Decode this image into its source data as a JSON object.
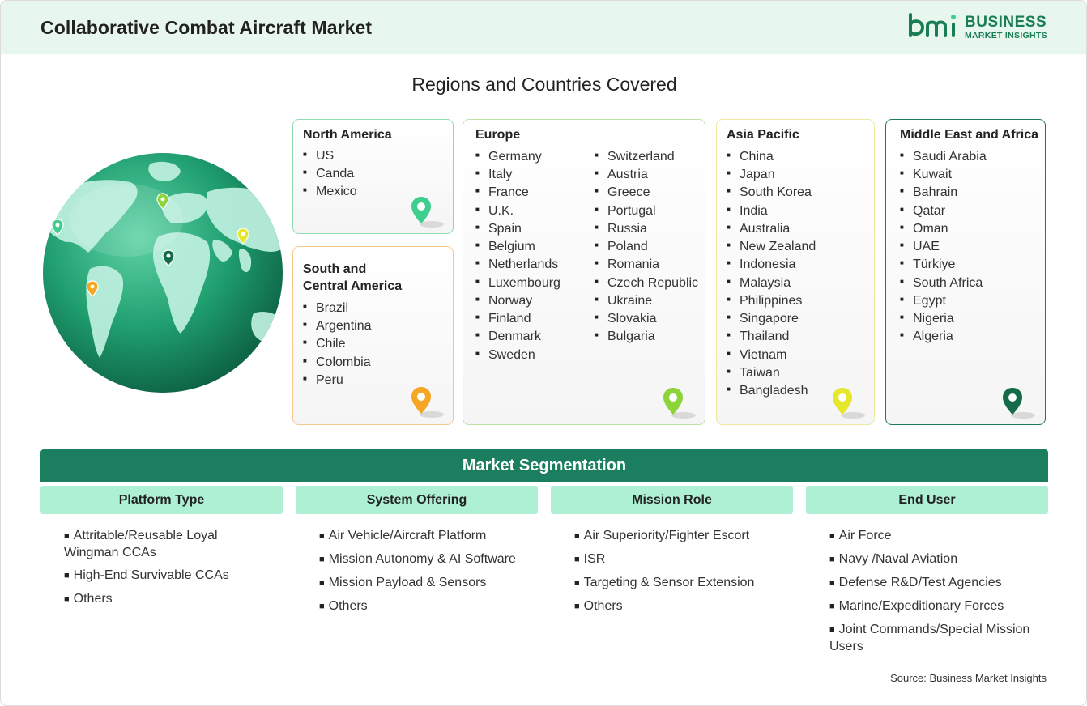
{
  "header": {
    "title": "Collaborative Combat Aircraft Market",
    "logo_line1": "BUSINESS",
    "logo_line2": "MARKET INSIGHTS",
    "brand_color": "#1a7d56"
  },
  "regions_title": "Regions and Countries Covered",
  "regions": {
    "north_america": {
      "title": "North America",
      "pin_color": "#3ecf8e",
      "countries": [
        "US",
        "Canda",
        "Mexico"
      ]
    },
    "south_central_america": {
      "title": "South and\nCentral America",
      "title_line1": "South and",
      "title_line2": "Central America",
      "pin_color": "#f5a623",
      "countries": [
        "Brazil",
        "Argentina",
        "Chile",
        "Colombia",
        "Peru"
      ]
    },
    "europe": {
      "title": "Europe",
      "pin_color": "#8cd43a",
      "countries_col1": [
        "Germany",
        "Italy",
        "France",
        "U.K.",
        "Spain",
        "Belgium",
        "Netherlands",
        "Luxembourg",
        "Norway",
        "Finland",
        "Denmark",
        "Sweden"
      ],
      "countries_col2": [
        "Switzerland",
        "Austria",
        "Greece",
        "Portugal",
        "Russia",
        "Poland",
        "Romania",
        "Czech Republic",
        "Ukraine",
        "Slovakia",
        "Bulgaria"
      ]
    },
    "asia_pacific": {
      "title": "Asia Pacific",
      "pin_color": "#e6e62a",
      "countries": [
        "China",
        "Japan",
        "South Korea",
        "India",
        "Australia",
        "New Zealand",
        "Indonesia",
        "Malaysia",
        "Philippines",
        "Singapore",
        "Thailand",
        "Vietnam",
        "Taiwan",
        "Bangladesh"
      ]
    },
    "middle_east_africa": {
      "title": "Middle East and Africa",
      "pin_color": "#146b47",
      "countries": [
        "Saudi Arabia",
        "Kuwait",
        "Bahrain",
        "Qatar",
        "Oman",
        "UAE",
        "Türkiye",
        "South Africa",
        "Egypt",
        "Nigeria",
        "Algeria"
      ]
    }
  },
  "segmentation": {
    "title": "Market Segmentation",
    "columns": [
      {
        "heading": "Platform Type",
        "items": [
          "Attritable/Reusable Loyal Wingman CCAs",
          "High-End Survivable CCAs",
          "Others"
        ]
      },
      {
        "heading": "System Offering",
        "items": [
          "Air Vehicle/Aircraft Platform",
          "Mission Autonomy & AI Software",
          "Mission Payload & Sensors",
          "Others"
        ]
      },
      {
        "heading": "Mission Role",
        "items": [
          "Air Superiority/Fighter Escort",
          "ISR",
          "Targeting & Sensor Extension",
          "Others"
        ]
      },
      {
        "heading": "End User",
        "items": [
          "Air Force",
          "Navy /Naval Aviation",
          "Defense R&D/Test Agencies",
          "Marine/Expeditionary Forces",
          "Joint Commands/Special Mission Users"
        ]
      }
    ]
  },
  "source": "Source: Business Market Insights"
}
